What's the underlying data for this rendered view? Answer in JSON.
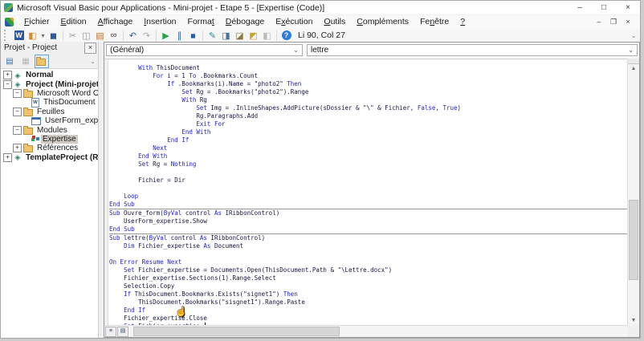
{
  "window": {
    "title": "Microsoft Visual Basic pour Applications - Mini-projet - Etape 5 - [Expertise (Code)]",
    "controls": [
      {
        "name": "minimize-button",
        "glyph": "–"
      },
      {
        "name": "maximize-button",
        "glyph": "□"
      },
      {
        "name": "close-button",
        "glyph": "×"
      }
    ]
  },
  "menu": {
    "items": [
      {
        "label": "Fichier",
        "u": 0
      },
      {
        "label": "Edition",
        "u": 0
      },
      {
        "label": "Affichage",
        "u": 0
      },
      {
        "label": "Insertion",
        "u": 0
      },
      {
        "label": "Format",
        "u": 5
      },
      {
        "label": "Débogage",
        "u": 0
      },
      {
        "label": "Exécution",
        "u": 1
      },
      {
        "label": "Outils",
        "u": 0
      },
      {
        "label": "Compléments",
        "u": 0
      },
      {
        "label": "Fenêtre",
        "u": 2
      },
      {
        "label": "?",
        "u": 0
      }
    ],
    "mdi_controls": [
      {
        "name": "mdi-minimize-button",
        "glyph": "–"
      },
      {
        "name": "mdi-restore-button",
        "glyph": "❐"
      },
      {
        "name": "mdi-close-button",
        "glyph": "×"
      }
    ]
  },
  "toolbar": {
    "status": "Li 90, Col 27",
    "icons": [
      {
        "type": "grip",
        "name": "toolbar-grip"
      },
      {
        "type": "word",
        "name": "view-word-icon",
        "glyph": "W"
      },
      {
        "type": "btn",
        "name": "insert-userform-icon",
        "glyph": "◧",
        "color": "#d98a2b"
      },
      {
        "type": "btn",
        "name": "insert-dropdown-icon",
        "glyph": "▾",
        "color": "#666",
        "narrow": true
      },
      {
        "type": "btn",
        "name": "save-icon",
        "glyph": "◼",
        "color": "#2c5aa0"
      },
      {
        "type": "sep"
      },
      {
        "type": "btn",
        "name": "cut-icon",
        "glyph": "✂",
        "color": "#9a9a9a",
        "disabled": true
      },
      {
        "type": "btn",
        "name": "copy-icon",
        "glyph": "◫",
        "color": "#9a9a9a",
        "disabled": true
      },
      {
        "type": "btn",
        "name": "paste-icon",
        "glyph": "▤",
        "color": "#b5742a"
      },
      {
        "type": "btn",
        "name": "find-icon",
        "glyph": "∞",
        "color": "#3a3a3a"
      },
      {
        "type": "sep"
      },
      {
        "type": "btn",
        "name": "undo-icon",
        "glyph": "↶",
        "color": "#2c5aa0"
      },
      {
        "type": "btn",
        "name": "redo-icon",
        "glyph": "↷",
        "color": "#aaaaaa",
        "disabled": true
      },
      {
        "type": "sep"
      },
      {
        "type": "btn",
        "name": "run-icon",
        "glyph": "▶",
        "color": "#2f9e44"
      },
      {
        "type": "btn",
        "name": "pause-icon",
        "glyph": "∥",
        "color": "#2c5aa0"
      },
      {
        "type": "btn",
        "name": "stop-icon",
        "glyph": "◼",
        "color": "#2c5aa0",
        "small": true
      },
      {
        "type": "sep"
      },
      {
        "type": "btn",
        "name": "design-mode-icon",
        "glyph": "✎",
        "color": "#2e8b8b"
      },
      {
        "type": "btn",
        "name": "project-explorer-icon",
        "glyph": "◨",
        "color": "#4a6fa5"
      },
      {
        "type": "btn",
        "name": "properties-window-icon",
        "glyph": "◪",
        "color": "#8a7a4a"
      },
      {
        "type": "btn",
        "name": "object-browser-icon",
        "glyph": "◩",
        "color": "#c9a227"
      },
      {
        "type": "btn",
        "name": "toolbox-icon",
        "glyph": "◧",
        "color": "#bbbbbb",
        "disabled": true
      },
      {
        "type": "sep"
      },
      {
        "type": "help",
        "name": "help-icon",
        "glyph": "?"
      },
      {
        "type": "status",
        "name": "line-col-status"
      },
      {
        "type": "overflow",
        "name": "toolbar-options-icon",
        "glyph": "⌄"
      }
    ]
  },
  "project_panel": {
    "title": "Projet - Project",
    "close_glyph": "×",
    "buttons": [
      {
        "name": "view-code-icon",
        "glyph": "▤",
        "color": "#3a6ea5"
      },
      {
        "name": "view-object-icon",
        "glyph": "▦",
        "color": "#b5b5b5"
      },
      {
        "name": "toggle-folders-icon",
        "glyph": "folder",
        "selected": true
      }
    ],
    "overflow_glyph": "⌄",
    "tree": [
      {
        "level": 0,
        "expander": "+",
        "icon": "project",
        "label": "Normal",
        "bold": true
      },
      {
        "level": 0,
        "expander": "−",
        "icon": "project",
        "label": "Project (Mini-projet - Et",
        "bold": true
      },
      {
        "level": 1,
        "expander": "−",
        "icon": "folder",
        "label": "Microsoft Word Objets"
      },
      {
        "level": 2,
        "expander": "",
        "icon": "worddoc",
        "label": "ThisDocument"
      },
      {
        "level": 1,
        "expander": "−",
        "icon": "folder",
        "label": "Feuilles"
      },
      {
        "level": 2,
        "expander": "",
        "icon": "userform",
        "label": "UserForm_expertise"
      },
      {
        "level": 1,
        "expander": "−",
        "icon": "folder",
        "label": "Modules"
      },
      {
        "level": 2,
        "expander": "",
        "icon": "module",
        "label": "Expertise",
        "selected": true
      },
      {
        "level": 1,
        "expander": "+",
        "icon": "folder",
        "label": "Références"
      },
      {
        "level": 0,
        "expander": "+",
        "icon": "project",
        "label": "TemplateProject (Rapp",
        "bold": true
      }
    ]
  },
  "code_window": {
    "left_combo": "(Général)",
    "right_combo": "lettre",
    "code": {
      "keywords": [
        "With",
        "End",
        "For",
        "To",
        "If",
        "Then",
        "Set",
        "False",
        "True",
        "Exit",
        "Next",
        "Nothing",
        "Loop",
        "Sub",
        "ByVal",
        "As",
        "Dim",
        "On",
        "Error",
        "Resume",
        "Do"
      ],
      "separators_after": [
        17,
        20
      ],
      "caret_line": 32,
      "lines": [
        "        With ThisDocument",
        "            For i = 1 To .Bookmarks.Count",
        "                If .Bookmarks(i).Name = \"photo2\" Then",
        "                    Set Rg = .Bookmarks(\"photo2\").Range",
        "                    With Rg",
        "                        Set Img = .InlineShapes.AddPicture(sDossier & \"\\\" & Fichier, False, True)",
        "                        Rg.Paragraphs.Add",
        "                        Exit For",
        "                    End With",
        "                End If",
        "            Next",
        "        End With",
        "        Set Rg = Nothing",
        "",
        "        Fichier = Dir",
        "",
        "    Loop",
        "End Sub",
        "Sub Ouvre_form(ByVal control As IRibbonControl)",
        "    UserForm_expertise.Show",
        "End Sub",
        "Sub lettre(ByVal control As IRibbonControl)",
        "    Dim Fichier_expertise As Document",
        "",
        "On Error Resume Next",
        "    Set Fichier_expertise = Documents.Open(ThisDocument.Path & \"\\Lettre.docx\")",
        "    Fichier_expertise.Sections(1).Range.Select",
        "    Selection.Copy",
        "    If ThisDocument.Bookmarks.Exists(\"signet1\") Then",
        "        ThisDocument.Bookmarks(\"sisgnet1\").Range.Paste",
        "    End If",
        "    Fichier_expertise.Close",
        "    Set Fichier_expertise "
      ]
    }
  },
  "colors": {
    "keyword": "#2323c8",
    "code_text": "#16163e",
    "selection_bg": "#cfcbc3",
    "titlebar_bg": "#ffffff"
  }
}
